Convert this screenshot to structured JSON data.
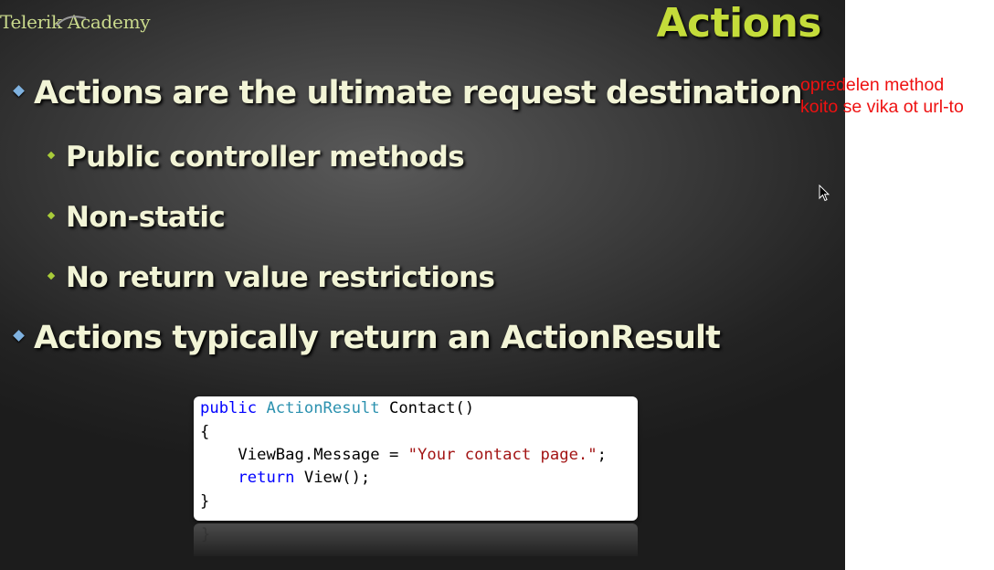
{
  "slide": {
    "logo_text": "Telerik Academy",
    "title": "Actions",
    "bullets": [
      {
        "level": 1,
        "text": "Actions are the ultimate request destination"
      },
      {
        "level": 2,
        "text": "Public controller methods"
      },
      {
        "level": 2,
        "text": "Non-static"
      },
      {
        "level": 2,
        "text": "No return value restrictions"
      },
      {
        "level": 1,
        "text": "Actions typically return an ActionResult"
      }
    ],
    "code": {
      "line1": {
        "kw": "public",
        "type": "ActionResult",
        "rest": " Contact()"
      },
      "line2": {
        "text": "{"
      },
      "line3": {
        "indent": "    ",
        "pre": "ViewBag.Message = ",
        "str": "\"Your contact page.\"",
        "post": ";"
      },
      "line4": {
        "indent": "    ",
        "kw": "return",
        "rest": " View();"
      },
      "line5": {
        "text": "}"
      }
    },
    "reflection_brace": "}"
  },
  "annotation": {
    "line1": "opredelen method",
    "line2": "koito se vika ot url-to"
  },
  "colors": {
    "title": "#c4dc3a",
    "logo": "#c9d98c",
    "bullet_text": "#f2f4d6",
    "bullet_l1_marker": "#7fb2e0",
    "bullet_l2_marker": "#a9cc3a",
    "annotation": "#ee1111",
    "code_keyword": "#0000ff",
    "code_type": "#2b91af",
    "code_string": "#a31515"
  },
  "icons": {
    "cursor": "mouse-pointer-icon"
  }
}
